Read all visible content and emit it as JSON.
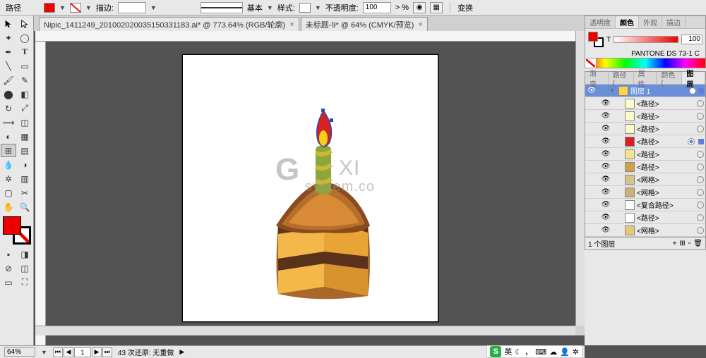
{
  "topbar": {
    "label_path": "路径",
    "stroke_label": "描边:",
    "basic_label": "基本",
    "style_label": "样式:",
    "opacity_label": "不透明度:",
    "opacity_value": "100",
    "opacity_unit": "> %",
    "transform_label": "变换"
  },
  "tabs": [
    {
      "title": "Nipic_1411249_201002020035150331183.ai* @ 773.64% (RGB/轮廓)"
    },
    {
      "title": "未标题-9* @ 64% (CMYK/预览)"
    }
  ],
  "color_panel": {
    "tabs": [
      "透明度",
      "颜色",
      "外观",
      "描边"
    ],
    "active_tab": 1,
    "channel": "T",
    "value": "100",
    "swatch_name": "PANTONE DS 73-1 C"
  },
  "layers_panel": {
    "tabs": [
      "渐变",
      "路径(",
      "属性",
      "颜色(",
      "图层"
    ],
    "active_tab": 4,
    "parent": {
      "name": "图层 1",
      "color": "#ffd24a"
    },
    "items": [
      {
        "name": "<路径>",
        "thumb": "#fffacd"
      },
      {
        "name": "<路径>",
        "thumb": "#fffacd"
      },
      {
        "name": "<路径>",
        "thumb": "#fffacd"
      },
      {
        "name": "<路径>",
        "thumb": "#d92020",
        "selected": true
      },
      {
        "name": "<路径>",
        "thumb": "#f0e68c"
      },
      {
        "name": "<路径>",
        "thumb": "#cfa24a"
      },
      {
        "name": "<网格>",
        "thumb": "#d8c48a"
      },
      {
        "name": "<网格>",
        "thumb": "#c9b178"
      },
      {
        "name": "<复合路径>",
        "thumb": "#fff"
      },
      {
        "name": "<路径>",
        "thumb": "#fff"
      },
      {
        "name": "<网格>",
        "thumb": "#e8c878"
      }
    ],
    "status": "1 个图层"
  },
  "statusbar": {
    "zoom": "64%",
    "page": "1",
    "undo_text": "43 次还原: 无重做"
  },
  "ime": {
    "lang": "英"
  },
  "watermark": {
    "text1": "G",
    "text2": "XI",
    "text3": "system.co"
  }
}
